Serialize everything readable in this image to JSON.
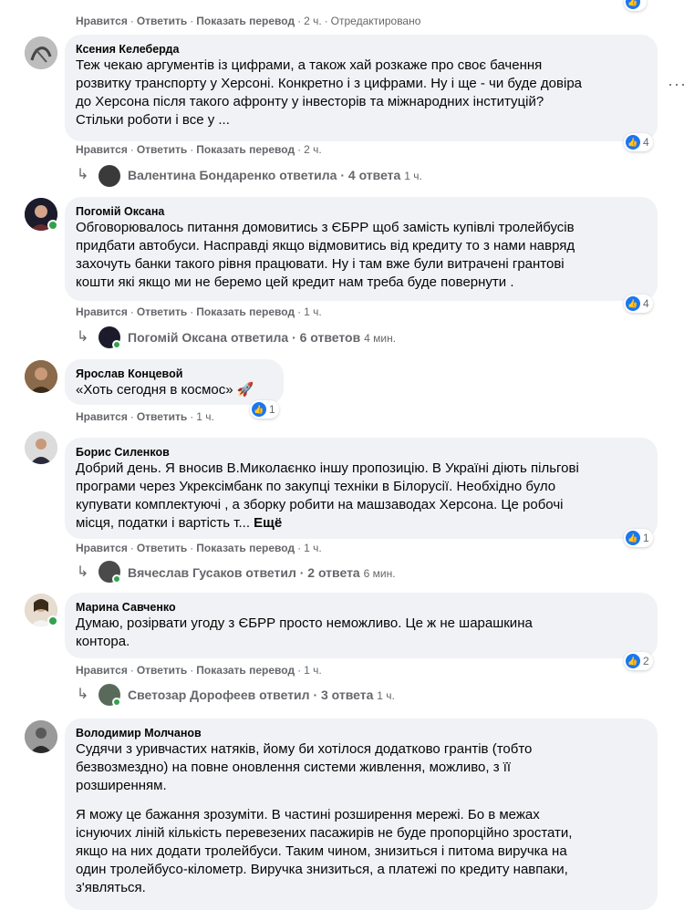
{
  "common": {
    "like": "Нравится",
    "reply": "Ответить",
    "translate": "Показать перевод",
    "sep": "·",
    "edited": "Отредактировано",
    "more": "Ещё"
  },
  "top_actions": {
    "time": "2 ч."
  },
  "comments": [
    {
      "author": "Ксения Келеберда",
      "lines": [
        "Теж чекаю аргументів із цифрами, а також хай розкаже про своє бачення",
        "розвитку транспорту у Херсоні. Конкретно і з цифрами. Ну і ще - чи буде довіра",
        "до Херсона після такого афронту у інвесторів та міжнародних інституцій?",
        "Стільки роботи і все у ..."
      ],
      "time": "2 ч.",
      "reactions": "4",
      "replies": {
        "text": "Валентина Бондаренко ответила · 4 ответа",
        "time": "1 ч."
      }
    },
    {
      "author": "Погомій Оксана",
      "lines": [
        "Обговорювалось питання домовитись з ЄБРР щоб замість купівлі тролейбусів",
        "придбати автобуси. Насправді якщо відмовитись від кредиту то з нами навряд",
        "захочуть банки такого рівня працювати. Ну і там вже були витрачені грантові",
        "кошти які якщо ми не беремо цей кредит нам треба буде повернути ."
      ],
      "time": "1 ч.",
      "reactions": "4",
      "replies": {
        "text": "Погомій Оксана ответила · 6 ответов",
        "time": "4 мин."
      }
    },
    {
      "author": "Ярослав Концевой",
      "lines": [
        "«Хоть сегодня в космос» 🚀"
      ],
      "time": "1 ч.",
      "reactions": "1"
    },
    {
      "author": "Борис Силенков",
      "lines": [
        "Добрий день. Я вносив В.Миколаєнко іншу пропозицію. В Україні діють пільгові",
        "програми через Укрексімбанк по закупці техніки в Білорусії. Необхідно було",
        "купувати комплектуючі , а зборку робити на машзаводах Херсона. Це робочі",
        "місця, податки і вартість т..."
      ],
      "time": "1 ч.",
      "reactions": "1",
      "replies": {
        "text": "Вячеслав Гусаков ответил · 2 ответа",
        "time": "6 мин."
      }
    },
    {
      "author": "Марина Савченко",
      "lines": [
        "Думаю, розірвати угоду з ЄБРР просто неможливо. Це ж не шарашкина",
        "контора."
      ],
      "time": "1 ч.",
      "reactions": "2",
      "replies": {
        "text": "Светозар Дорофеев ответил · 3 ответа",
        "time": "1 ч."
      }
    },
    {
      "author": "Володимир Молчанов",
      "lines": [
        "Судячи з уривчастих натяків, йому би хотілося додатково грантів (тобто",
        "безвозмездно) на повне оновлення системи живлення, можливо, з її",
        "розширенням."
      ],
      "lines2": [
        "Я можу це бажання зрозуміти. В частині розширення мережі. Бо в межах",
        "існуючих ліній кількість перевезених пасажирів не буде пропорційно зростати,",
        "якщо на них додати тролейбуси. Таким чином, знизиться і питома виручка на",
        "один тролейбусо-кілометр. Виручка знизиться, а платежі по кредиту навпаки,",
        "з'являться."
      ]
    }
  ],
  "colors": {
    "bubble": "#f0f2f5",
    "muted": "#65676b",
    "like": "#1877f2",
    "online": "#31a24c"
  }
}
